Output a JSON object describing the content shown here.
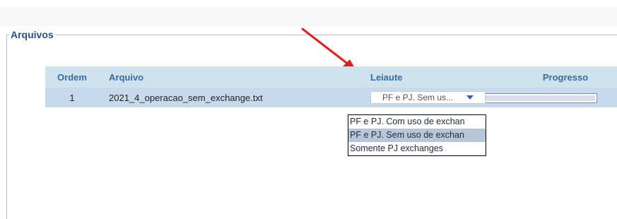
{
  "fieldset": {
    "legend": "Arquivos"
  },
  "table": {
    "headers": {
      "ordem": "Ordem",
      "arquivo": "Arquivo",
      "leiaute": "Leiaute",
      "progresso": "Progresso"
    },
    "rows": [
      {
        "ordem": "1",
        "arquivo": "2021_4_operacao_sem_exchange.txt",
        "leiaute": "PF e PJ. Sem us...",
        "progress_fraction": 0
      }
    ]
  },
  "dropdown": {
    "options": [
      "PF e PJ. Com uso de exchan",
      "PF e PJ. Sem uso de exchan",
      "Somente PJ exchanges"
    ],
    "selected_index": 1
  },
  "colors": {
    "header_bg": "#cfe3ee",
    "row_bg": "#c7d9ea",
    "accent": "#3a6ba0",
    "annotation_arrow": "#e02020"
  },
  "icons": {
    "select_caret": "chevron-down-icon",
    "annotation": "red-arrow-icon"
  }
}
